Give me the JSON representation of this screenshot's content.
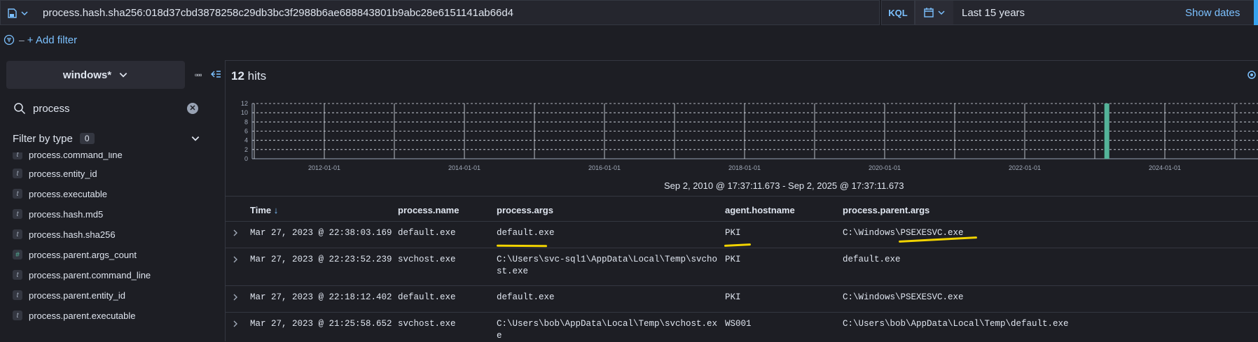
{
  "query": {
    "text": "process.hash.sha256:018d37cbd3878258c29db3bc3f2988b6ae688843801b9abc28e6151141ab66d4",
    "language": "KQL",
    "date_range": "Last 15 years",
    "show_dates": "Show dates"
  },
  "filters": {
    "add_filter": "+ Add filter"
  },
  "sidebar": {
    "index_pattern": "windows*",
    "search_value": "process",
    "filter_by_type": "Filter by type",
    "filter_count": "0",
    "fields": [
      {
        "name": "process.command_line",
        "type": "t"
      },
      {
        "name": "process.entity_id",
        "type": "t"
      },
      {
        "name": "process.executable",
        "type": "t"
      },
      {
        "name": "process.hash.md5",
        "type": "t"
      },
      {
        "name": "process.hash.sha256",
        "type": "t"
      },
      {
        "name": "process.parent.args_count",
        "type": "#"
      },
      {
        "name": "process.parent.command_line",
        "type": "t"
      },
      {
        "name": "process.parent.entity_id",
        "type": "t"
      },
      {
        "name": "process.parent.executable",
        "type": "t"
      }
    ]
  },
  "results": {
    "count": "12",
    "hits_label": "hits"
  },
  "chart_data": {
    "type": "bar",
    "ylim": [
      0,
      12
    ],
    "yticks": [
      "0",
      "2",
      "4",
      "6",
      "8",
      "10",
      "12"
    ],
    "xticks": [
      "2012-01-01",
      "2014-01-01",
      "2016-01-01",
      "2018-01-01",
      "2020-01-01",
      "2022-01-01",
      "2024-01-01"
    ],
    "bars": [
      {
        "x": "2023-03",
        "value": 12
      }
    ],
    "grid": true,
    "bar_color": "#54b399"
  },
  "time_range_label": "Sep 2, 2010 @ 17:37:11.673 - Sep 2, 2025 @ 17:37:11.673",
  "table": {
    "columns": [
      "Time",
      "process.name",
      "process.args",
      "agent.hostname",
      "process.parent.args"
    ],
    "sort_indicator": "↓",
    "rows": [
      {
        "time": "Mar 27, 2023 @ 22:38:03.169",
        "name": "default.exe",
        "args": "default.exe",
        "host": "PKI",
        "parent_args": "C:\\Windows\\PSEXESVC.exe"
      },
      {
        "time": "Mar 27, 2023 @ 22:23:52.239",
        "name": "svchost.exe",
        "args": "C:\\Users\\svc-sql1\\AppData\\Local\\Temp\\svcho\nst.exe",
        "host": "PKI",
        "parent_args": "default.exe"
      },
      {
        "time": "Mar 27, 2023 @ 22:18:12.402",
        "name": "default.exe",
        "args": "default.exe",
        "host": "PKI",
        "parent_args": "C:\\Windows\\PSEXESVC.exe"
      },
      {
        "time": "Mar 27, 2023 @ 21:25:58.652",
        "name": "svchost.exe",
        "args": "C:\\Users\\bob\\AppData\\Local\\Temp\\svchost.ex\ne",
        "host": "WS001",
        "parent_args": "C:\\Users\\bob\\AppData\\Local\\Temp\\default.exe"
      }
    ]
  },
  "colors": {
    "accent": "#7cc1ff",
    "highlight": "#f1d300",
    "background": "#1d1e24"
  }
}
